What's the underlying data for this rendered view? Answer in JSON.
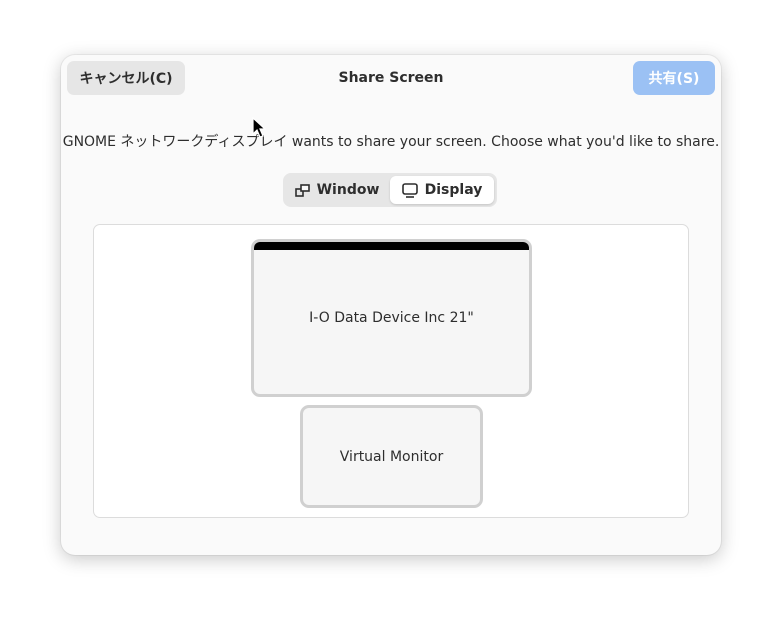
{
  "dialog": {
    "title": "Share Screen",
    "cancel_label": "キャンセル(C)",
    "share_label": "共有(S)",
    "description": "GNOME ネットワークディスプレイ wants to share your screen. Choose what you'd like to share."
  },
  "switcher": {
    "window_label": "Window",
    "display_label": "Display",
    "selected": "Display"
  },
  "monitors": [
    {
      "label": "I-O Data Device Inc 21\"",
      "primary": true
    },
    {
      "label": "Virtual Monitor",
      "primary": false
    }
  ],
  "colors": {
    "accent_disabled": "#9bc1f4",
    "dialog_bg": "#fafafa",
    "panel_bg": "#ffffff"
  },
  "icons": {
    "window": "window-icon",
    "display": "display-icon",
    "cursor": "mouse-pointer-icon"
  }
}
